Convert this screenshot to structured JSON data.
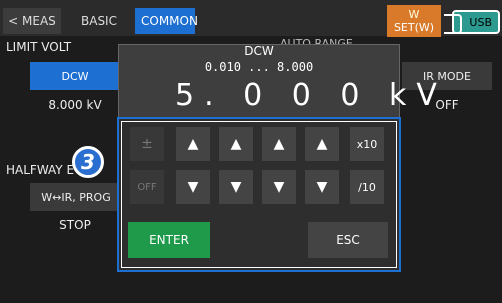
{
  "topbar": {
    "tabs": [
      "< MEAS",
      "BASIC",
      "COMMON"
    ],
    "setw_top": "W",
    "setw_bottom": "SET(W)",
    "usb": "USB"
  },
  "left": {
    "limit_label": "LIMIT VOLT",
    "dcw_button": "DCW",
    "dcw_value": "8.000 kV",
    "halfway_label": "HALFWAY E",
    "step_number": "3",
    "wir_button": "W↔IR, PROG",
    "wir_value": "STOP"
  },
  "right": {
    "irmode_button": "IR MODE",
    "irmode_value": "OFF"
  },
  "dialog": {
    "background_text": "AUTO RANGE",
    "title": "DCW",
    "range": "0.010 ... 8.000",
    "value": "5. 0  0  0 kV",
    "keys": {
      "plusminus": "±",
      "off": "OFF",
      "x10": "x10",
      "div10": "/10",
      "enter": "ENTER",
      "esc": "ESC"
    }
  }
}
